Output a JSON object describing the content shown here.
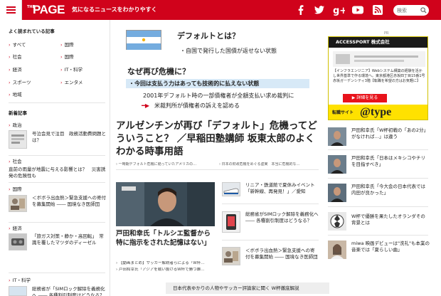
{
  "header": {
    "logo_pre": "THE",
    "logo": "PAGE",
    "tagline": "気になるニュースをわかりやすく",
    "search_placeholder": "検索"
  },
  "sidebar": {
    "ranking_title": "よく読まれている記事",
    "categories": [
      {
        "label": "すべて"
      },
      {
        "label": "国際"
      },
      {
        "label": "社会"
      },
      {
        "label": "国際"
      },
      {
        "label": "経済"
      },
      {
        "label": "IT・科学"
      },
      {
        "label": "スポーツ"
      },
      {
        "label": "エンタメ"
      },
      {
        "label": "地域"
      }
    ],
    "new_title": "新着記事",
    "sections": [
      {
        "label": "政治",
        "items": [
          {
            "text": "号泣会見で注目　政務活動費問題とは？"
          }
        ]
      },
      {
        "label": "社会",
        "items": [
          {
            "text": "直前の雨量が地震に与える影響とは？　災害誘発の危険性も"
          }
        ]
      },
      {
        "label": "国際",
        "items": [
          {
            "text": "＜ボボラ出血熱＞緊急支援への寄付を募集開始 ―― 国境なき医師団"
          }
        ]
      },
      {
        "label": "経済",
        "items": [
          {
            "text": "「旅ガス対策・静か・高回転」　常識を覆したマツダのディーゼル"
          }
        ]
      },
      {
        "label": "IT・科学",
        "items": [
          {
            "text": "総務省が「SIMロック解除を義務化へ ―― 各種割引制度はどうなる？"
          }
        ]
      }
    ]
  },
  "hero": {
    "title": "デフォルトとは？",
    "line1": "・自国で発行した国債が返せない状態",
    "question": "なぜ再び危機に？",
    "highlight": "・今回は支払う力はあっても技術的に払えない状態",
    "line2": "2001年デフォルト時の一部債権者が全額支払い求め裁判に",
    "line3": "米裁判所が債権者の訴えを認める"
  },
  "main_article": {
    "title": "アルゼンチンが再び「デフォルト」危機ってどういうこと？ ／早稲田塾講師 坂東太郎のよくわかる時事用語",
    "related": [
      "一時期デフォルト危機に陥っていたアメリカの…",
      "日本の財政危機をめぐる虚実　本当に危機的な…"
    ]
  },
  "mid_article": {
    "title": "戸田和幸氏「トルシエ監督から特に指示をされた記憶はない」",
    "related": [
      "【動画まとめ】サッカー解説者らによる「W杯…",
      "戸田和幸氏「アジアを戦い抜けるW杯で勝つ難…"
    ]
  },
  "center_list": [
    {
      "text": "リニア・鉄道館で夏休みイベント「新幹線、再発見！」／愛知"
    },
    {
      "text": "総務省がSIMロック解除を義務化へ ―― 各種割引制度はどうなる？"
    },
    {
      "text": "＜ボボラ出血熱＞緊急支援への寄付を募集開始 ―― 国境なき医師団"
    }
  ],
  "bottom_banner": "日本代表ゆかりの人物やサッカー評論家に聞く W杯徹底解説",
  "ad": {
    "pr_label": "PR",
    "company": "ACCESSPORT 株式会社",
    "body": "【インフラエンジニア】Webシステム構築の経験を活かし世界基準で作る環境へ。東京都港区赤坂四丁目15番1号 赤坂ガーデンシティ3階【転職を希望の方はお気軽に】",
    "button": "詳細を見る",
    "footer_label": "転職サイト",
    "footer_logo": "@type"
  },
  "right_list": [
    {
      "text": "戸田和幸氏「W杯初戦の「あの2分」がなければ…」は違う"
    },
    {
      "text": "戸田和幸氏「日本はメキシコやチリを目指すべき」"
    },
    {
      "text": "戸田和幸氏「今大会の日本代表では内田が良かった」"
    },
    {
      "text": "W杯で優勝を果たしたオランダその背景とは"
    },
    {
      "text": "miwa 映画デビューは\"洗礼\"も本業の音楽では「夏らしい曲」"
    }
  ],
  "colors": {
    "brand": "#d0021b",
    "ad_yellow": "#ffe100"
  }
}
